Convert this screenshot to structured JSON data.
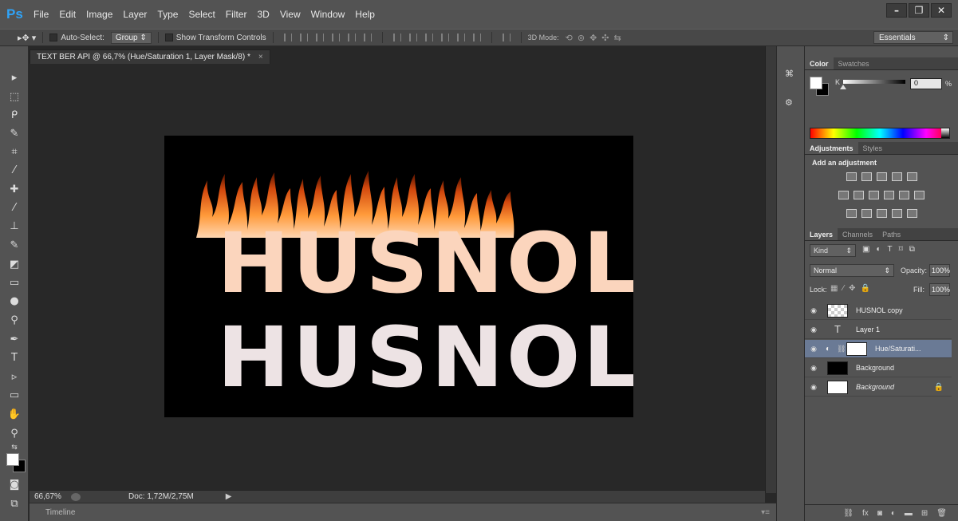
{
  "app": {
    "logo": "Ps"
  },
  "menu": [
    "File",
    "Edit",
    "Image",
    "Layer",
    "Type",
    "Select",
    "Filter",
    "3D",
    "View",
    "Window",
    "Help"
  ],
  "window_controls": {
    "minimize": "–",
    "restore": "❐",
    "close": "✕"
  },
  "options": {
    "auto_select_label": "Auto-Select:",
    "auto_select_target": "Group",
    "show_transform_label": "Show Transform Controls",
    "mode_3d_label": "3D Mode:",
    "workspace": "Essentials"
  },
  "document": {
    "tab_title": "TEXT BER API @ 66,7% (Hue/Saturation 1, Layer Mask/8) *",
    "tab_close": "×",
    "fire_text": "HUSNOL",
    "plain_text": "HUSNOL",
    "zoom": "66,67%",
    "doc_info": "Doc: 1,72M/2,75M"
  },
  "timeline": {
    "label": "Timeline"
  },
  "color_panel": {
    "tabs": [
      "Color",
      "Swatches"
    ],
    "channel_label": "K",
    "channel_value": "0",
    "unit": "%",
    "channel_level": 0
  },
  "adjustments_panel": {
    "tabs": [
      "Adjustments",
      "Styles"
    ],
    "title": "Add an adjustment"
  },
  "layers_panel": {
    "tabs": [
      "Layers",
      "Channels",
      "Paths"
    ],
    "filter_kind": "Kind",
    "blend_mode": "Normal",
    "opacity_label": "Opacity:",
    "opacity_value": "100%",
    "lock_label": "Lock:",
    "fill_label": "Fill:",
    "fill_value": "100%",
    "layers": [
      {
        "name": "HUSNOL copy",
        "thumb": "checker"
      },
      {
        "name": "Layer 1",
        "thumb": "type"
      },
      {
        "name": "Hue/Saturati...",
        "thumb": "adjust",
        "selected": true
      },
      {
        "name": "Background",
        "thumb": "dark-text"
      },
      {
        "name": "Background",
        "thumb": "white",
        "italic": true,
        "locked": true
      }
    ]
  },
  "colors": {
    "accent_logo": "#2fa3f7",
    "fire_letter": "#fbd5bd",
    "plain_letter": "#ede3e4",
    "selected_layer": "#6a7a95"
  }
}
